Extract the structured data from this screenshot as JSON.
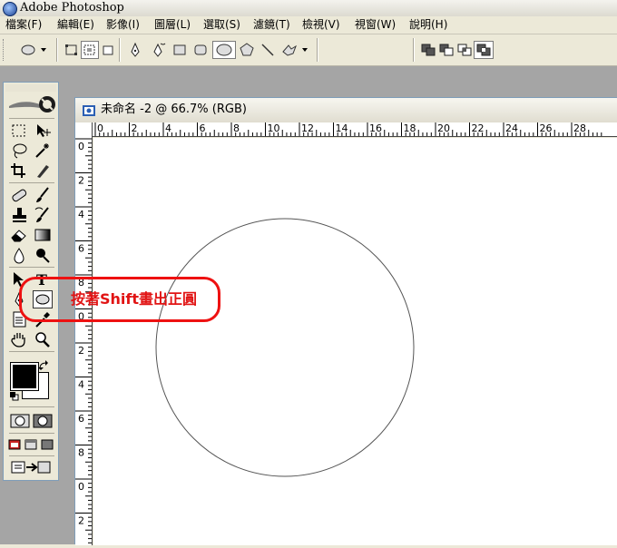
{
  "app": {
    "title": "Adobe Photoshop"
  },
  "menu": [
    {
      "id": "file",
      "label": "檔案(F)"
    },
    {
      "id": "edit",
      "label": "編輯(E)"
    },
    {
      "id": "image",
      "label": "影像(I)"
    },
    {
      "id": "layer",
      "label": "圖層(L)"
    },
    {
      "id": "select",
      "label": "選取(S)"
    },
    {
      "id": "filter",
      "label": "濾鏡(T)"
    },
    {
      "id": "view",
      "label": "檢視(V)"
    },
    {
      "id": "window",
      "label": "視窗(W)"
    },
    {
      "id": "help",
      "label": "說明(H)"
    }
  ],
  "options_bar": {
    "tool_preset_icon": "ellipse-preset-icon",
    "selected_shape": "ellipse",
    "shape_layer_mode_pressed": true
  },
  "toolbox": {
    "selected_tool": "ellipse-tool",
    "foreground_color": "#000000",
    "background_color": "#ffffff"
  },
  "document": {
    "title": "未命名 -2 @ 66.7% (RGB)",
    "ruler_top_labels": [
      "0",
      "2",
      "4",
      "6",
      "8",
      "10",
      "12",
      "14",
      "16",
      "18",
      "20",
      "22",
      "24",
      "26",
      "28"
    ],
    "ruler_left_labels": [
      "0",
      "2",
      "4",
      "6",
      "8",
      "0",
      "2",
      "4",
      "6",
      "8",
      "0",
      "2"
    ],
    "circle_shape": "circle outline"
  },
  "annotation": {
    "text": "按著Shift畫出正圓",
    "color": "#e11414"
  }
}
